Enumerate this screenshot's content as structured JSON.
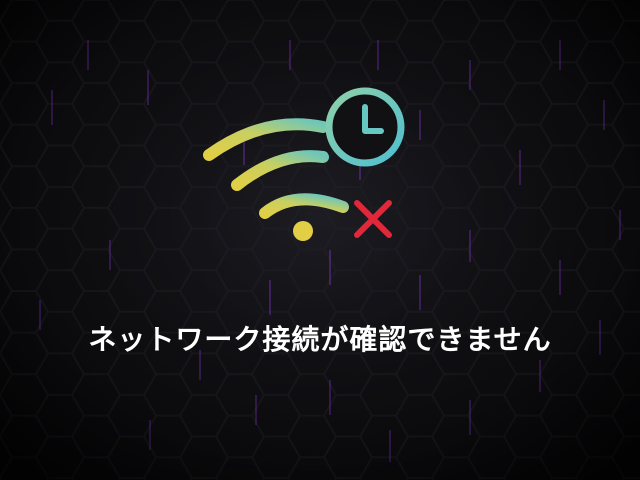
{
  "message": {
    "text": "ネットワーク接続が確認できません"
  },
  "icons": {
    "wifi": "wifi-icon",
    "clock": "clock-icon",
    "error": "close-x-icon"
  },
  "colors": {
    "background": "#121216",
    "hex_outline": "#1b1b21",
    "hex_glow": "#6b2aa8",
    "wifi_gradient_start": "#d8c94a",
    "wifi_gradient_end": "#6fc3b3",
    "clock_stroke": "#5fc9c4",
    "error_x": "#e0283a",
    "text": "#ffffff"
  }
}
